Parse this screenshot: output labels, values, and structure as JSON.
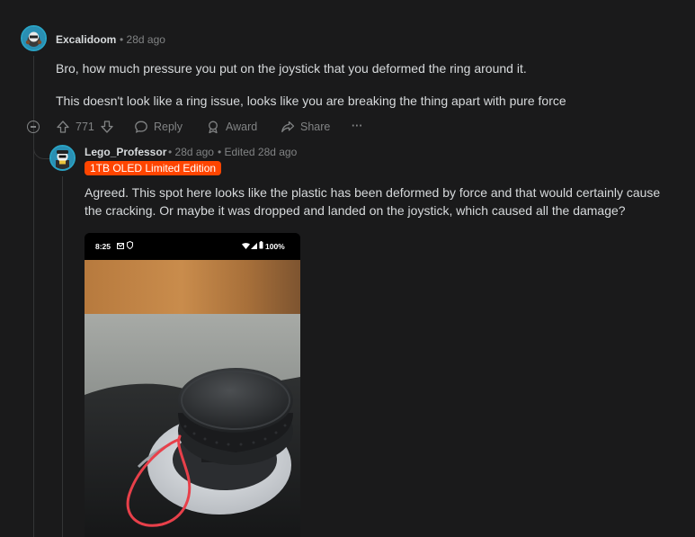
{
  "comment1": {
    "username": "Excalidoom",
    "time": "• 28d ago",
    "paragraphs": [
      "Bro, how much pressure you put on the joystick that you deformed the ring around it.",
      "This doesn't look like a ring issue, looks like you are breaking the thing apart with pure force"
    ],
    "actions": {
      "upvote_icon": "arrow-up-icon",
      "score": "771",
      "downvote_icon": "arrow-down-icon",
      "reply": "Reply",
      "award": "Award",
      "share": "Share",
      "more": "···"
    }
  },
  "comment2": {
    "username": "Lego_Professor",
    "time": "• 28d ago",
    "edited": "• Edited 28d ago",
    "flair": "1TB OLED Limited Edition",
    "flair_color": "#ff4500",
    "paragraph": "Agreed. This spot here looks like the plastic has been deformed by force and that would certainly cause the cracking. Or maybe it was dropped and landed on the joystick, which caused all the damage?",
    "image": {
      "status_time": "8:25",
      "status_battery": "100%"
    }
  },
  "colors": {
    "background": "#1a1a1b",
    "text": "#d7dadc",
    "muted": "#818384",
    "annotation": "#e8404a"
  }
}
